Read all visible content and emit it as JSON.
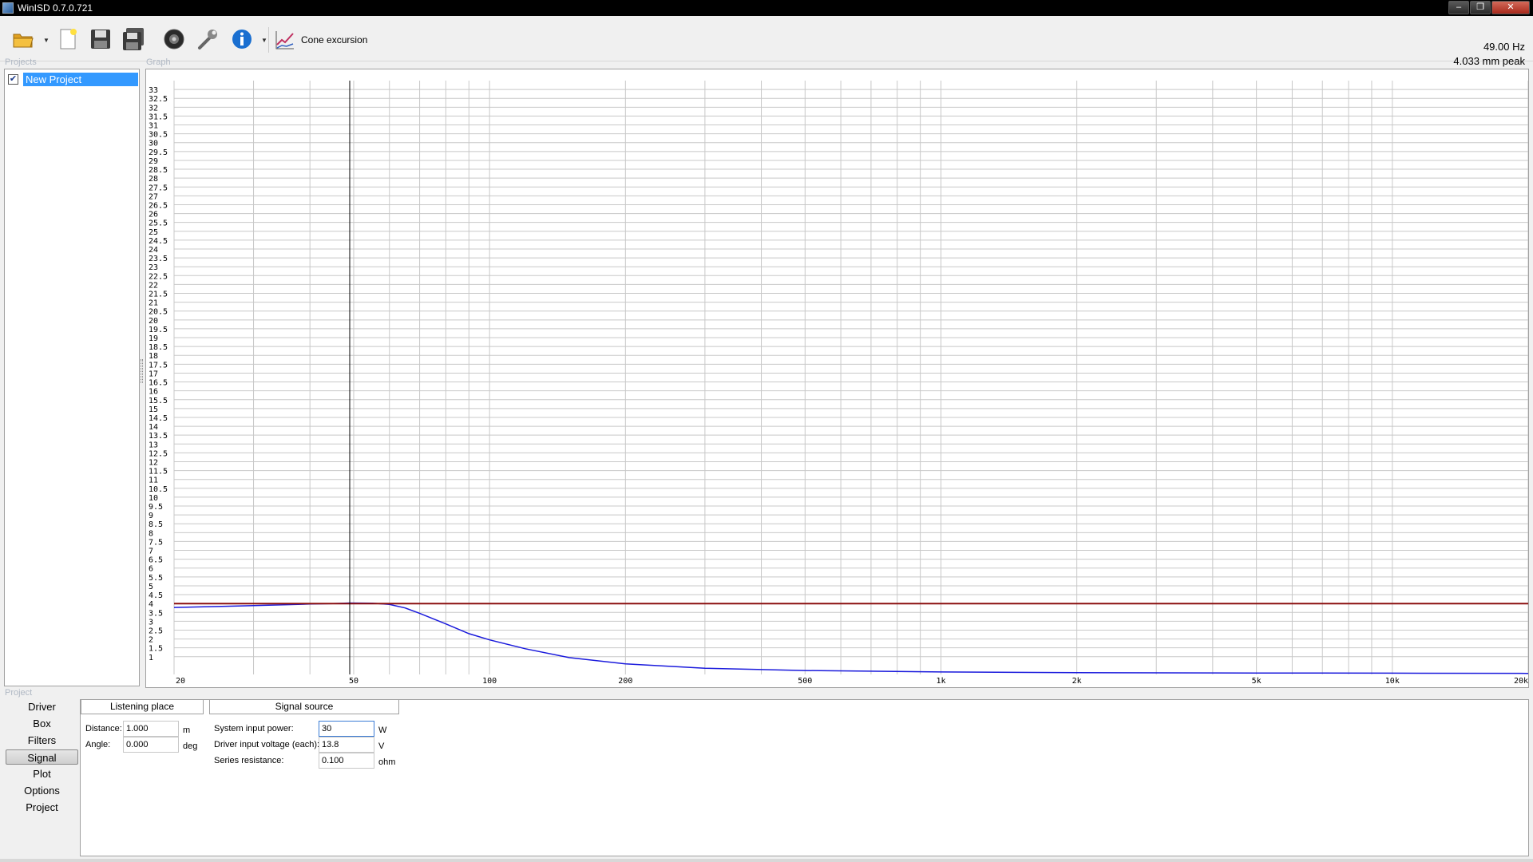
{
  "window": {
    "title": "WinISD 0.7.0.721",
    "controls": {
      "minimize": "‒",
      "maximize": "❐",
      "close": "✕"
    }
  },
  "toolbar": {
    "buttons": [
      {
        "icon": "open-folder-icon",
        "has_dropdown": true
      },
      {
        "icon": "new-document-icon",
        "has_dropdown": false
      },
      {
        "icon": "save-icon",
        "has_dropdown": false
      },
      {
        "icon": "save-all-icon",
        "has_dropdown": false
      },
      {
        "icon": "driver-speaker-icon",
        "has_dropdown": false
      },
      {
        "icon": "wrench-icon",
        "has_dropdown": false
      },
      {
        "icon": "info-icon",
        "has_dropdown": true
      }
    ],
    "graph_type_label": "Cone excursion",
    "dropdown_arrow": "▼",
    "readout": {
      "frequency": "49.00 Hz",
      "value": "4.033 mm peak"
    }
  },
  "groups": {
    "projects": "Projects",
    "graph": "Graph",
    "project": "Project"
  },
  "projects": [
    {
      "name": "New Project",
      "checked": true,
      "check_glyph": "✔"
    }
  ],
  "graph": {
    "cursor_frequency_hz": 49,
    "colors": {
      "excursion": "#1a1adc",
      "xmax": "#8b1010",
      "grid": "#c8c8c8",
      "cursor": "#000000"
    }
  },
  "chart_data": {
    "type": "line",
    "title": "",
    "xlabel": "",
    "ylabel": "",
    "x_scale": "log",
    "xlim": [
      20,
      20000
    ],
    "ylim": [
      0,
      33.5
    ],
    "x_tick_labels": [
      {
        "value": 20,
        "label": "20"
      },
      {
        "value": 50,
        "label": "50"
      },
      {
        "value": 100,
        "label": "100"
      },
      {
        "value": 200,
        "label": "200"
      },
      {
        "value": 500,
        "label": "500"
      },
      {
        "value": 1000,
        "label": "1k"
      },
      {
        "value": 2000,
        "label": "2k"
      },
      {
        "value": 5000,
        "label": "5k"
      },
      {
        "value": 10000,
        "label": "10k"
      },
      {
        "value": 20000,
        "label": "20k"
      }
    ],
    "y_tick_labels": [
      "1",
      "1.5",
      "2",
      "2.5",
      "3",
      "3.5",
      "4",
      "4.5",
      "5",
      "5.5",
      "6",
      "6.5",
      "7",
      "7.5",
      "8",
      "8.5",
      "9",
      "9.5",
      "10",
      "10.5",
      "11",
      "11.5",
      "12",
      "12.5",
      "13",
      "13.5",
      "14",
      "14.5",
      "15",
      "15.5",
      "16",
      "16.5",
      "17",
      "17.5",
      "18",
      "18.5",
      "19",
      "19.5",
      "20",
      "20.5",
      "21",
      "21.5",
      "22",
      "22.5",
      "23",
      "23.5",
      "24",
      "24.5",
      "25",
      "25.5",
      "26",
      "26.5",
      "27",
      "27.5",
      "28",
      "28.5",
      "29",
      "29.5",
      "30",
      "30.5",
      "31",
      "31.5",
      "32",
      "32.5",
      "33"
    ],
    "grid": true,
    "series": [
      {
        "color": "#1a1adc",
        "x": [
          20,
          25,
          30,
          35,
          40,
          45,
          49,
          55,
          60,
          65,
          70,
          80,
          90,
          100,
          120,
          150,
          200,
          300,
          500,
          1000,
          2000,
          5000,
          10000,
          20000
        ],
        "y": [
          3.78,
          3.83,
          3.88,
          3.93,
          3.97,
          4.0,
          4.03,
          4.02,
          3.95,
          3.75,
          3.45,
          2.85,
          2.3,
          1.95,
          1.45,
          0.95,
          0.6,
          0.35,
          0.22,
          0.14,
          0.1,
          0.08,
          0.07,
          0.06
        ]
      },
      {
        "color": "#8b1010",
        "x": [
          20,
          20000
        ],
        "y": [
          4.0,
          4.0
        ]
      }
    ]
  },
  "nav": {
    "items": [
      "Driver",
      "Box",
      "Filters",
      "Signal",
      "Plot",
      "Options",
      "Project"
    ],
    "active": "Signal"
  },
  "signal": {
    "tabs": {
      "listening": "Listening place",
      "source": "Signal source"
    },
    "distance": {
      "label": "Distance:",
      "value": "1.000",
      "unit": "m"
    },
    "angle": {
      "label": "Angle:",
      "value": "0.000",
      "unit": "deg"
    },
    "power": {
      "label": "System input power:",
      "value": "30",
      "unit": "W"
    },
    "voltage": {
      "label": "Driver input voltage (each):",
      "value": "13.8",
      "unit": "V"
    },
    "resistance": {
      "label": "Series resistance:",
      "value": "0.100",
      "unit": "ohm"
    }
  }
}
